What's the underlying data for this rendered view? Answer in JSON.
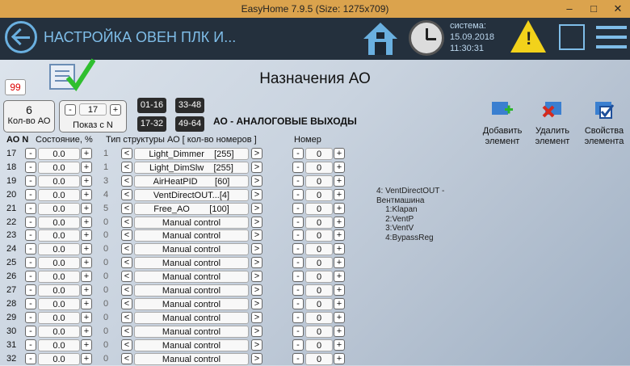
{
  "window": {
    "title": "EasyHome 7.9.5 (Size: 1275x709)"
  },
  "appbar": {
    "title": "НАСТРОЙКА ОВЕН ПЛК И...",
    "system_label": "система:",
    "date": "15.09.2018",
    "time": "11:30:31",
    "warning_glyph": "!"
  },
  "page": {
    "heading": "Назначения АО",
    "badge": "99",
    "count": {
      "value": "6",
      "label": "Кол-во АО"
    },
    "show": {
      "value": "17",
      "label": "Показ с N"
    },
    "ranges": [
      "01-16",
      "33-48",
      "17-32",
      "49-64"
    ],
    "section_title": "АО - АНАЛОГОВЫЕ ВЫХОДЫ"
  },
  "actions": [
    {
      "label": "Добавить элемент",
      "icon": "add-icon"
    },
    {
      "label": "Удалить элемент",
      "icon": "delete-icon"
    },
    {
      "label": "Свойства элемента",
      "icon": "properties-icon"
    }
  ],
  "columns": {
    "ao_n": "АО N",
    "state": "Состояние, %",
    "type": "Тип структуры АО [ кол-во номеров ]",
    "number": "Номер"
  },
  "rows": [
    {
      "n": "17",
      "state": "0.0",
      "type": "1",
      "label": "Light_Dimmer    [255]",
      "num": "0"
    },
    {
      "n": "18",
      "state": "0.0",
      "type": "1",
      "label": "Light_DimSlw    [255]",
      "num": "0"
    },
    {
      "n": "19",
      "state": "0.0",
      "type": "3",
      "label": "AirHeatPID       [60]",
      "num": "0"
    },
    {
      "n": "20",
      "state": "0.0",
      "type": "4",
      "label": "VentDirectOUT...[4]",
      "num": "0"
    },
    {
      "n": "21",
      "state": "0.0",
      "type": "5",
      "label": "Free_AO        [100]",
      "num": "0"
    },
    {
      "n": "22",
      "state": "0.0",
      "type": "0",
      "label": "Manual control",
      "num": "0"
    },
    {
      "n": "23",
      "state": "0.0",
      "type": "0",
      "label": "Manual control",
      "num": "0"
    },
    {
      "n": "24",
      "state": "0.0",
      "type": "0",
      "label": "Manual control",
      "num": "0"
    },
    {
      "n": "25",
      "state": "0.0",
      "type": "0",
      "label": "Manual control",
      "num": "0"
    },
    {
      "n": "26",
      "state": "0.0",
      "type": "0",
      "label": "Manual control",
      "num": "0"
    },
    {
      "n": "27",
      "state": "0.0",
      "type": "0",
      "label": "Manual control",
      "num": "0"
    },
    {
      "n": "28",
      "state": "0.0",
      "type": "0",
      "label": "Manual control",
      "num": "0"
    },
    {
      "n": "29",
      "state": "0.0",
      "type": "0",
      "label": "Manual control",
      "num": "0"
    },
    {
      "n": "30",
      "state": "0.0",
      "type": "0",
      "label": "Manual control",
      "num": "0"
    },
    {
      "n": "31",
      "state": "0.0",
      "type": "0",
      "label": "Manual control",
      "num": "0"
    },
    {
      "n": "32",
      "state": "0.0",
      "type": "0",
      "label": "Manual control",
      "num": "0"
    }
  ],
  "info_text": "4: VentDirectOUT -\nВентмашина\n    1:Klapan\n    2:VentP\n    3:VentV\n    4:BypassReg"
}
